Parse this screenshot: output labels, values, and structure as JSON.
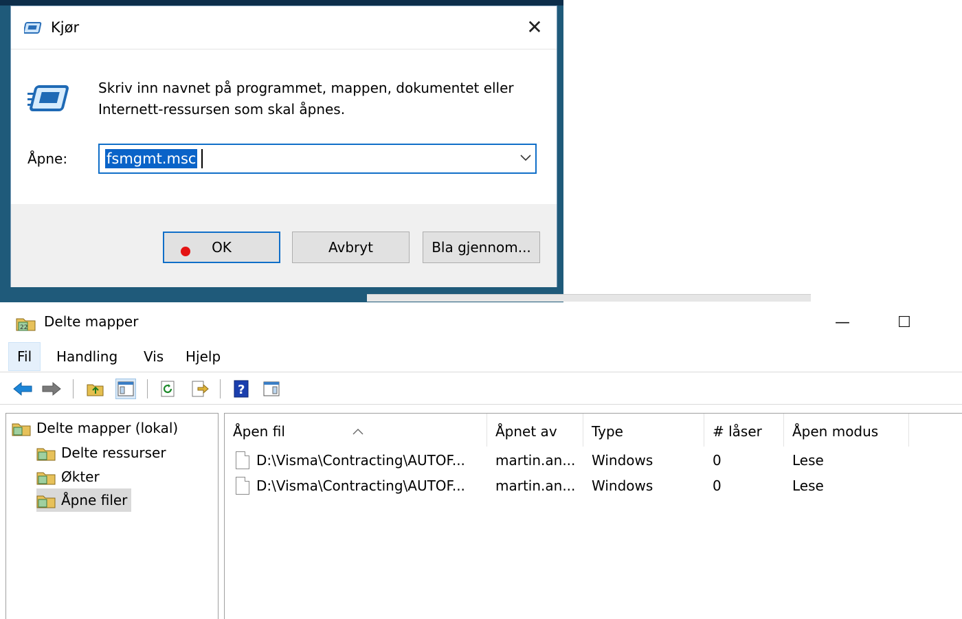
{
  "run_dialog": {
    "title": "Kjør",
    "close_glyph": "✕",
    "description_line1": "Skriv inn navnet på programmet, mappen, dokumentet eller",
    "description_line2": "Internett-ressursen som skal åpnes.",
    "open_label": "Åpne:",
    "open_value": "fsmgmt.msc",
    "buttons": {
      "ok": "OK",
      "cancel": "Avbryt",
      "browse": "Bla gjennom..."
    },
    "colors": {
      "focus": "#0f6ec8",
      "selection": "#0a63c8",
      "red_dot": "#e41313"
    }
  },
  "mmc": {
    "title": "Delte mapper",
    "controls": {
      "minimize": "—",
      "maximize": "☐"
    },
    "menu": [
      "Fil",
      "Handling",
      "Vis",
      "Hjelp"
    ],
    "tree": {
      "root": "Delte mapper (lokal)",
      "children": [
        "Delte ressurser",
        "Økter",
        "Åpne filer"
      ]
    },
    "columns": [
      "Åpen fil",
      "Åpnet av",
      "Type",
      "# låser",
      "Åpen modus"
    ],
    "rows": [
      {
        "file": "D:\\Visma\\Contracting\\AUTOF...",
        "user": "martin.an...",
        "type": "Windows",
        "locks": "0",
        "mode": "Lese"
      },
      {
        "file": "D:\\Visma\\Contracting\\AUTOF...",
        "user": "martin.an...",
        "type": "Windows",
        "locks": "0",
        "mode": "Lese"
      }
    ]
  }
}
